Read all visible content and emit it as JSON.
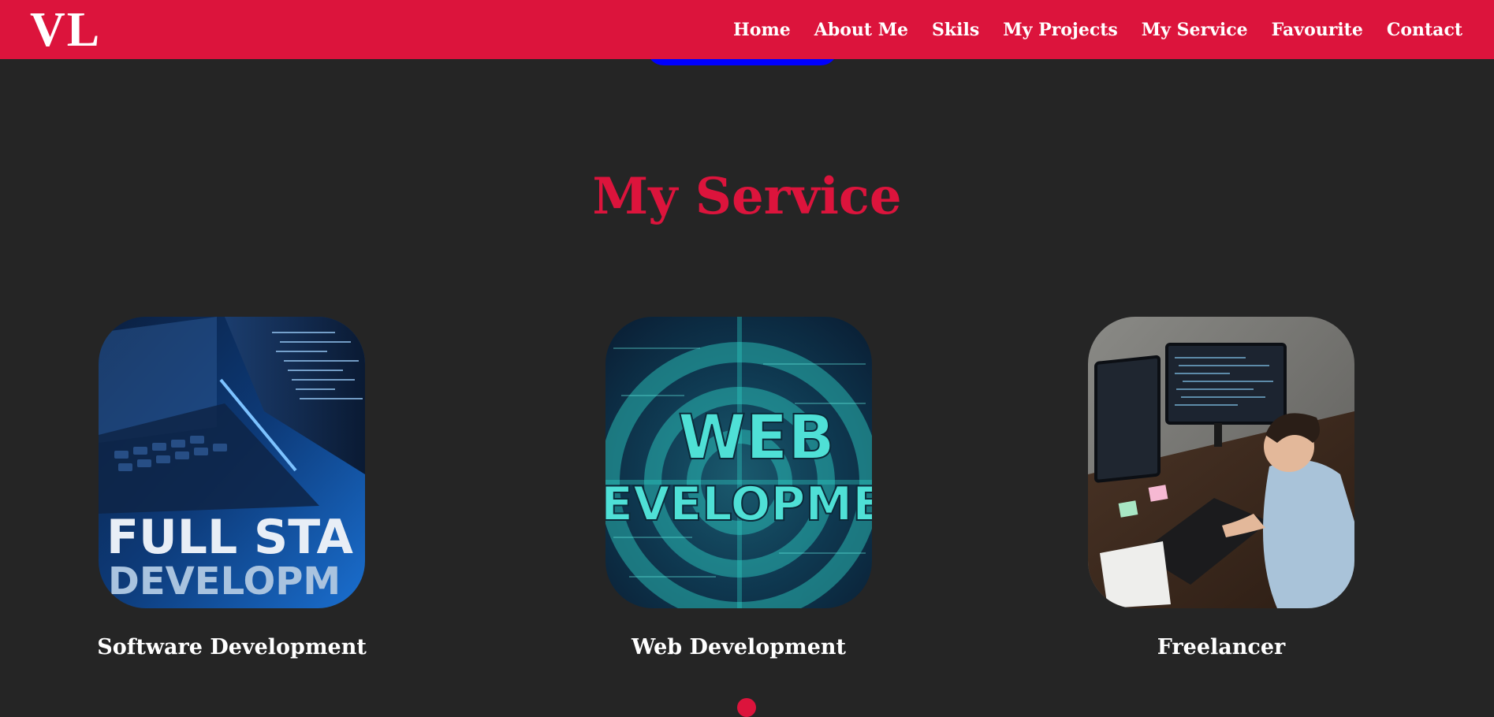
{
  "logo": "VL",
  "nav": {
    "items": [
      {
        "label": "Home"
      },
      {
        "label": "About Me"
      },
      {
        "label": "Skils"
      },
      {
        "label": "My Projects"
      },
      {
        "label": "My Service"
      },
      {
        "label": "Favourite"
      },
      {
        "label": "Contact"
      }
    ]
  },
  "section": {
    "title": "My Service"
  },
  "services": [
    {
      "label": "Software Development",
      "image_text": [
        "FULL STA",
        "DEVELOPM"
      ]
    },
    {
      "label": "Web Development",
      "image_text": [
        "WEB",
        "EVELOPME"
      ]
    },
    {
      "label": "Freelancer"
    }
  ],
  "colors": {
    "accent": "#dc143c",
    "background": "#252525",
    "button": "#0000ff",
    "text": "#ffffff"
  }
}
